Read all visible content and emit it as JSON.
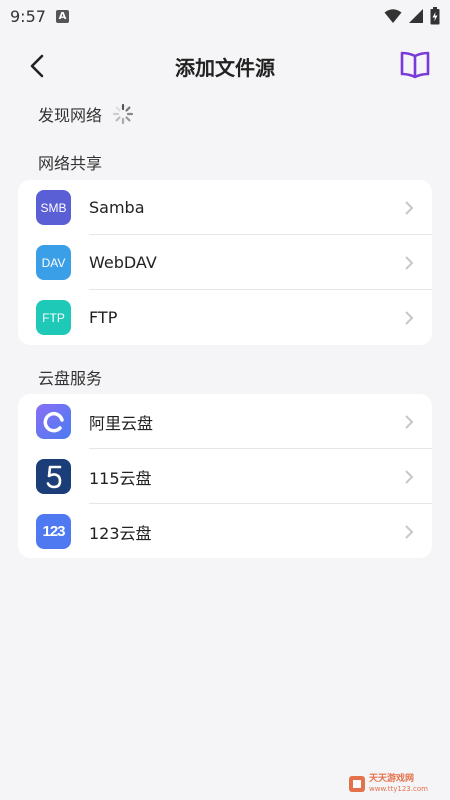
{
  "status_bar": {
    "time": "9:57",
    "notif_badge": "A"
  },
  "app_bar": {
    "title": "添加文件源"
  },
  "discover": {
    "label": "发现网络"
  },
  "network_section": {
    "label": "网络共享",
    "items": [
      {
        "label": "Samba",
        "icon_text": "SMB",
        "icon_color": "#5b5fd6"
      },
      {
        "label": "WebDAV",
        "icon_text": "DAV",
        "icon_color": "#3a9fe6"
      },
      {
        "label": "FTP",
        "icon_text": "FTP",
        "icon_color": "#1fc9b8"
      }
    ]
  },
  "cloud_section": {
    "label": "云盘服务",
    "items": [
      {
        "label": "阿里云盘",
        "icon_color": "#6a6cf0"
      },
      {
        "label": "115云盘",
        "icon_color": "#1b3d78"
      },
      {
        "label": "123云盘",
        "icon_text": "123",
        "icon_color": "#4f79f0"
      }
    ]
  },
  "colors": {
    "accent": "#7a3ad8",
    "chevron": "#c7c7cc",
    "background": "#f5f5f7"
  },
  "watermark": {
    "line1": "天天游戏网",
    "line2": "www.tty123.com"
  }
}
